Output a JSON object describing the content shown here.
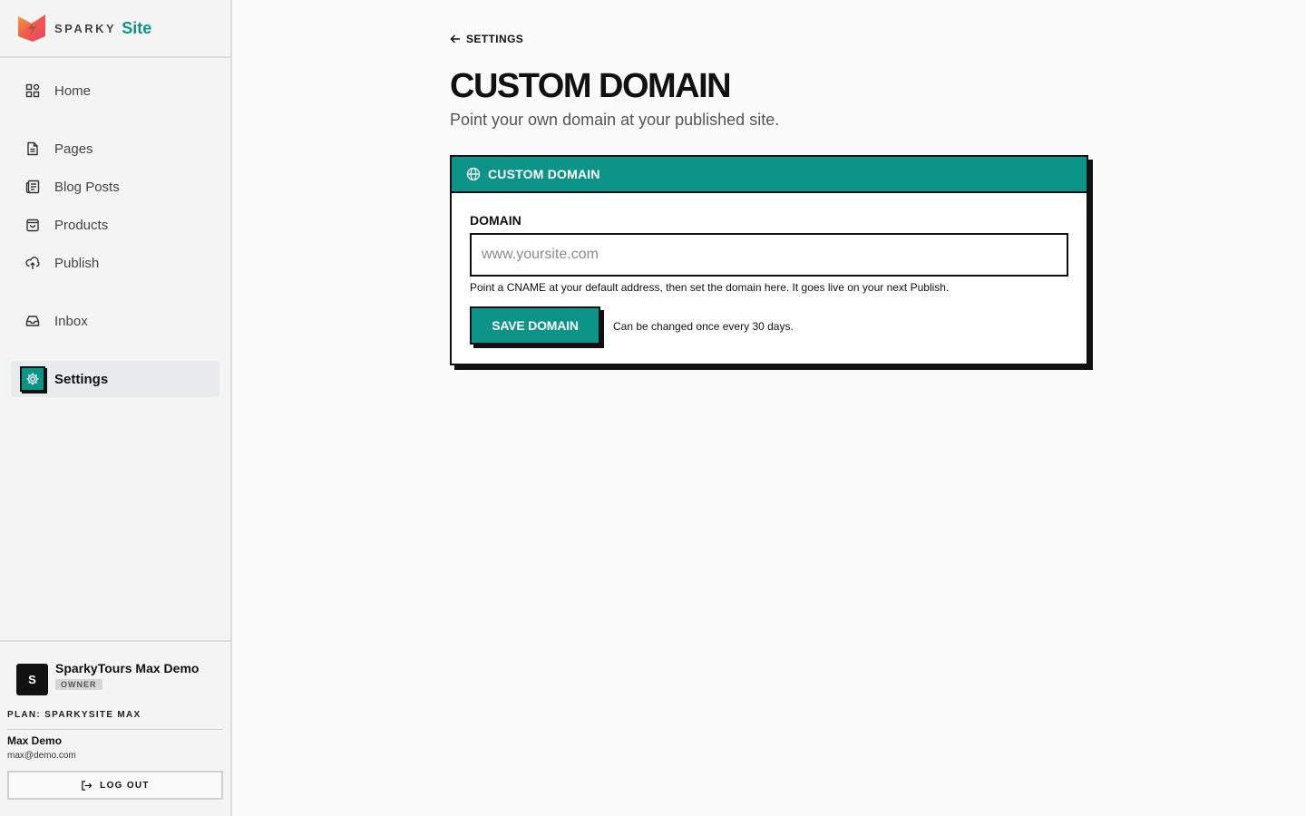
{
  "brand": {
    "word1": "SPARKY",
    "word2": "Site"
  },
  "nav": {
    "items": [
      {
        "label": "Home",
        "icon": "grid-icon"
      },
      {
        "label": "Pages",
        "icon": "file-icon"
      },
      {
        "label": "Blog Posts",
        "icon": "newspaper-icon"
      },
      {
        "label": "Products",
        "icon": "shopping-bag-icon"
      },
      {
        "label": "Publish",
        "icon": "cloud-upload-icon"
      },
      {
        "label": "Inbox",
        "icon": "inbox-icon"
      },
      {
        "label": "Settings",
        "icon": "gear-icon",
        "active": true
      }
    ]
  },
  "org": {
    "avatar": "S",
    "name": "SparkyTours Max Demo",
    "role": "OWNER"
  },
  "plan": "PLAN: SPARKYSITE MAX",
  "user": {
    "name": "Max Demo",
    "email": "max@demo.com"
  },
  "logout_label": "LOG OUT",
  "main": {
    "back_label": "SETTINGS",
    "title": "CUSTOM DOMAIN",
    "subtitle": "Point your own domain at your published site.",
    "card": {
      "title": "CUSTOM DOMAIN",
      "field_label": "DOMAIN",
      "placeholder": "www.yoursite.com",
      "value": "",
      "help": "Point a CNAME at your default address, then set the domain here. It goes live on your next Publish.",
      "save_label": "SAVE DOMAIN",
      "save_note": "Can be changed once every 30 days."
    }
  },
  "colors": {
    "accent": "#0c9488",
    "ink": "#111111",
    "background": "#fafafa",
    "sidebar": "#f4f4f4"
  }
}
